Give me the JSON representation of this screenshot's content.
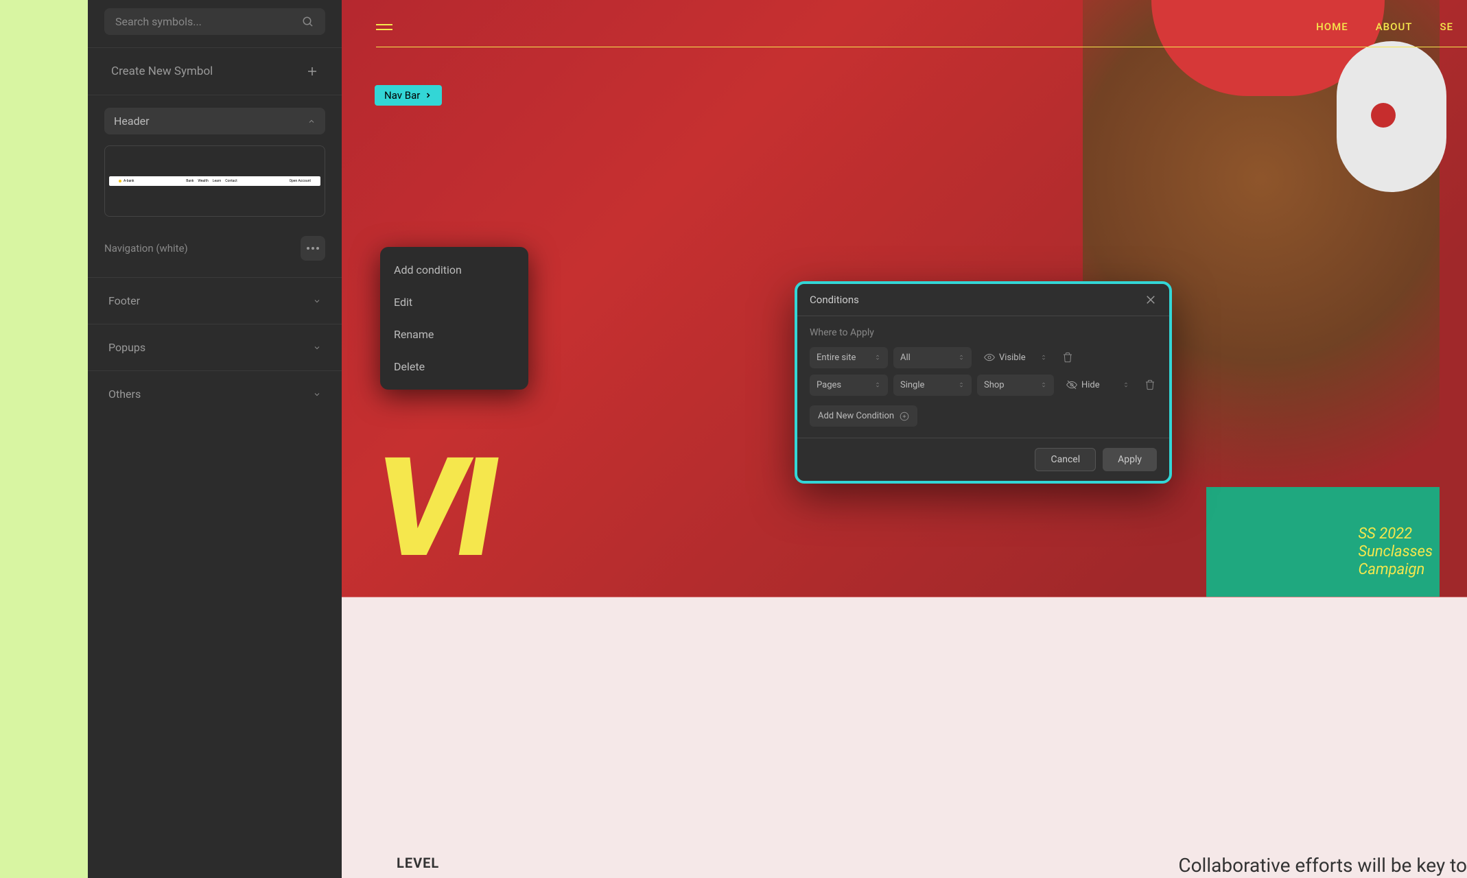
{
  "sidebar": {
    "search_placeholder": "Search symbols...",
    "create_symbol": "Create New Symbol",
    "sections": {
      "header": "Header",
      "footer": "Footer",
      "popups": "Popups",
      "others": "Others"
    },
    "symbol_name": "Navigation (white)",
    "thumbnail": {
      "brand": "A-bank",
      "links": [
        "Bank",
        "Wealth",
        "Learn",
        "Contact"
      ],
      "cta": "Open Account"
    }
  },
  "context_menu": {
    "add_condition": "Add condition",
    "edit": "Edit",
    "rename": "Rename",
    "delete": "Delete"
  },
  "canvas": {
    "nav_links": [
      "HOME",
      "ABOUT",
      "SE"
    ],
    "navbar_badge": "Nav Bar",
    "campaign": "SS 2022\nSunclasses\nCampaign",
    "big_text": "VI",
    "level": "LEVEL",
    "collab": "Collaborative efforts will be key to"
  },
  "modal": {
    "title": "Conditions",
    "where_label": "Where to Apply",
    "rows": [
      {
        "scope": "Entire site",
        "filter": "All",
        "visibility": "Visible",
        "target": null
      },
      {
        "scope": "Pages",
        "filter": "Single",
        "visibility": "Hide",
        "target": "Shop"
      }
    ],
    "add_new": "Add New Condition",
    "cancel": "Cancel",
    "apply": "Apply"
  }
}
